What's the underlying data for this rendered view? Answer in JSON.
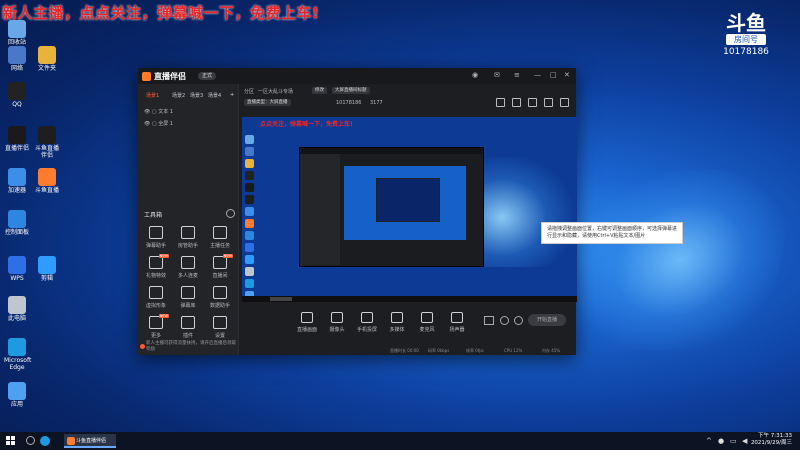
{
  "banner": {
    "text": "新人主播，点点关注，弹幕喊一下，免费上车!"
  },
  "douyu": {
    "logo": "斗鱼",
    "room_label": "房间号",
    "room_id": "10178186"
  },
  "desktop_icons": [
    {
      "label": "回收站",
      "color": "#6aa7e8"
    },
    {
      "label": "网络",
      "color": "#4a78c8"
    },
    {
      "label": "文件夹",
      "color": "#e9b23a"
    },
    {
      "label": "QQ",
      "color": "#222222"
    },
    {
      "label": "直播伴侣",
      "color": "#1a1a1a"
    },
    {
      "label": "斗鱼直播伴侣",
      "color": "#1e1e1e"
    },
    {
      "label": "加速器",
      "color": "#3d8ee8"
    },
    {
      "label": "斗鱼直播",
      "color": "#ff7b2e"
    },
    {
      "label": "控制面板",
      "color": "#2f86e0"
    },
    {
      "label": "WPS",
      "color": "#2e6fe8"
    },
    {
      "label": "剪辑",
      "color": "#2f9cff"
    },
    {
      "label": "此电脑",
      "color": "#bfc6d0"
    },
    {
      "label": "Microsoft Edge",
      "color": "#1e9be0"
    },
    {
      "label": "应用",
      "color": "#4fa0f0"
    }
  ],
  "app": {
    "title": "直播伴侣",
    "version": "正式",
    "scene_tabs": [
      "场景1",
      "场景2",
      "场景3",
      "场景4"
    ],
    "sources": [
      "文本 1",
      "全屏 1"
    ],
    "tools_title": "工具箱",
    "tools": [
      {
        "label": "弹幕助手",
        "new": false
      },
      {
        "label": "房管助手",
        "new": false
      },
      {
        "label": "主播任务",
        "new": false
      },
      {
        "label": "礼物特效",
        "new": true
      },
      {
        "label": "多人连麦",
        "new": false
      },
      {
        "label": "直播间",
        "new": true
      },
      {
        "label": "虚拟形象",
        "new": false
      },
      {
        "label": "弹幕库",
        "new": false
      },
      {
        "label": "数据助手",
        "new": false
      },
      {
        "label": "更多",
        "new": true
      },
      {
        "label": "插件",
        "new": false
      },
      {
        "label": "设置",
        "new": false
      }
    ],
    "footer_tip": "新人主播可获得流量扶持，请开启直播后领取奖励",
    "info": {
      "channel_label": "分区",
      "channel_value": "一区大乱斗专场",
      "edit_chip": "修改",
      "title_chip": "大屏直播间标题",
      "room_label": "直播类型：大屏直播",
      "room_id": "10178186",
      "follower_count": "3177"
    },
    "preview_banner": "点点关注，弹幕喊一下，免费上车!",
    "bottom_tools": [
      "直播画面",
      "摄像头",
      "手机投屏",
      "多媒体",
      "麦克风",
      "扬声器"
    ],
    "live_button": "开始直播",
    "status_items": [
      "直播时长 00:00",
      "码率 0kbps",
      "帧率 0fps",
      "CPU 12%",
      "内存 45%"
    ]
  },
  "tooltip": {
    "text": "请拖拽调整画面位置，右键可调整画面顺序，可选择弹幕进行显示和隐藏，请使用Ctrl+V粘贴文本/图片"
  },
  "taskbar": {
    "app_label": "斗鱼直播伴侣",
    "time": "下午 7:31:33",
    "date": "2021/9/29/周三"
  }
}
